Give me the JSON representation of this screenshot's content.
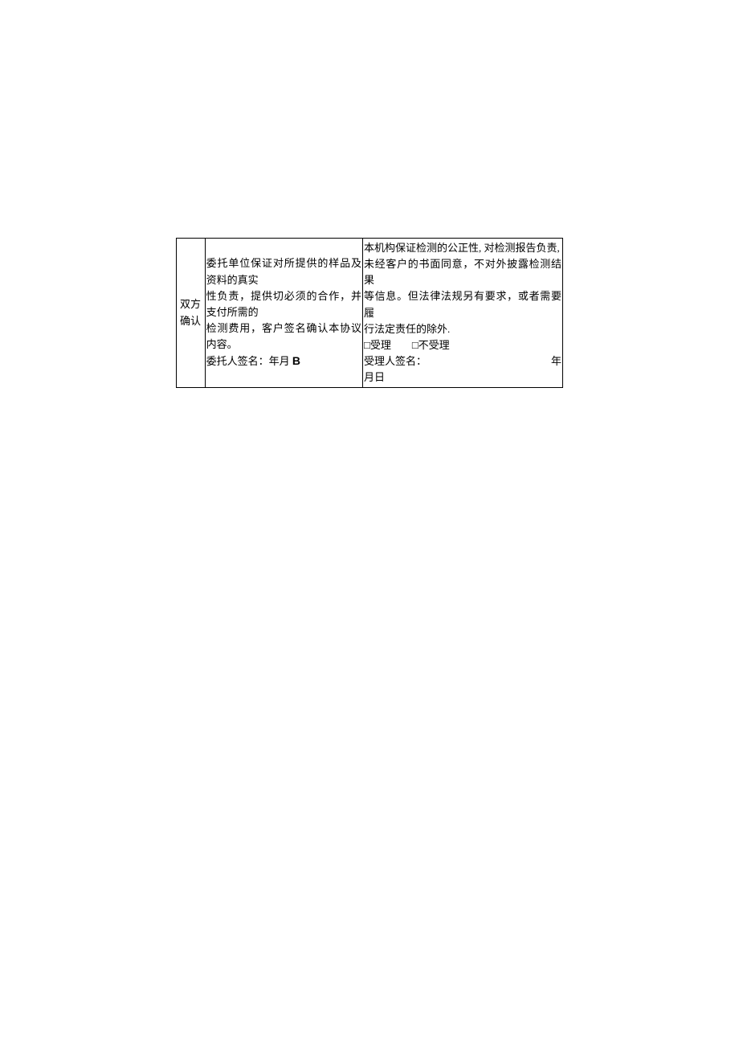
{
  "row": {
    "label_line1": "双方",
    "label_line2": "确认",
    "mid_line1": "委托单位保证对所提供的样品及资料的真实",
    "mid_line2": "性负责，提供切必须的合作，并支付所需的",
    "mid_line3": "检测费用，客户签名确认本协议内容。",
    "mid_sig_prefix": "委托人签名：年月 ",
    "mid_sig_b": "B",
    "right_line1": "本机构保证检测的公正性, 对检测报告负责,",
    "right_line2": "未经客户的书面同意，不对外披露检测结果",
    "right_line3": "等信息。但法律法规另有要求，或者需要履",
    "right_line4": "行法定责任的除外.",
    "right_cb": "□受理　　□不受理",
    "right_sig_label": "受理人签名：",
    "right_sig_year": "年",
    "right_date": "月日"
  }
}
